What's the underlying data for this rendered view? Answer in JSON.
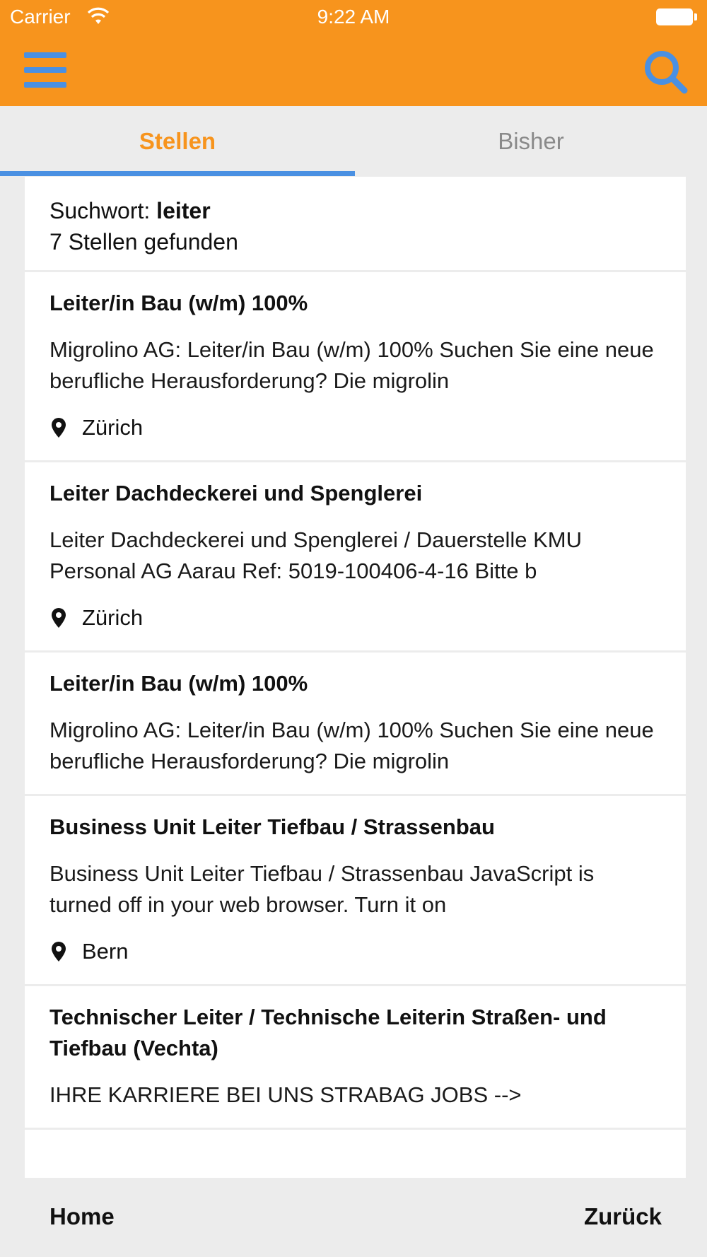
{
  "status_bar": {
    "carrier": "Carrier",
    "time": "9:22 AM",
    "icons": [
      "wifi-icon",
      "battery-icon"
    ]
  },
  "navbar": {
    "background": "#f7941d",
    "accent": "#4a90e2",
    "icons": [
      "hamburger-menu-icon",
      "search-icon"
    ]
  },
  "tabs": [
    {
      "label": "Stellen",
      "active": true
    },
    {
      "label": "Bisher",
      "active": false
    }
  ],
  "summary": {
    "keyword_label": "Suchwort:",
    "keyword": "leiter",
    "count_text": "7 Stellen gefunden"
  },
  "jobs": [
    {
      "title": "Leiter/in Bau (w/m) 100%",
      "description": "Migrolino AG: Leiter/in Bau (w/m) 100% Suchen Sie eine neue berufliche Herausforderung? Die migrolin",
      "location": "Zürich"
    },
    {
      "title": "Leiter Dachdeckerei und Spenglerei",
      "description": "Leiter Dachdeckerei und Spenglerei / Dauerstelle KMU Personal AG Aarau Ref: 5019-100406-4-16 Bitte b",
      "location": "Zürich"
    },
    {
      "title": "Leiter/in Bau (w/m) 100%",
      "description": "Migrolino AG: Leiter/in Bau (w/m) 100% Suchen Sie eine neue berufliche Herausforderung? Die migrolin",
      "location": null
    },
    {
      "title": "Business Unit Leiter Tiefbau / Strassenbau",
      "description": "Business Unit Leiter Tiefbau / Strassenbau JavaScript is turned off in your web browser. Turn it on",
      "location": "Bern"
    },
    {
      "title": "Technischer Leiter / Technische Leiterin Straßen- und Tiefbau (Vechta)",
      "description": "IHRE KARRIERE BEI UNS STRABAG JOBS -->",
      "location": null
    }
  ],
  "bottom_bar": {
    "home_label": "Home",
    "back_label": "Zurück"
  }
}
